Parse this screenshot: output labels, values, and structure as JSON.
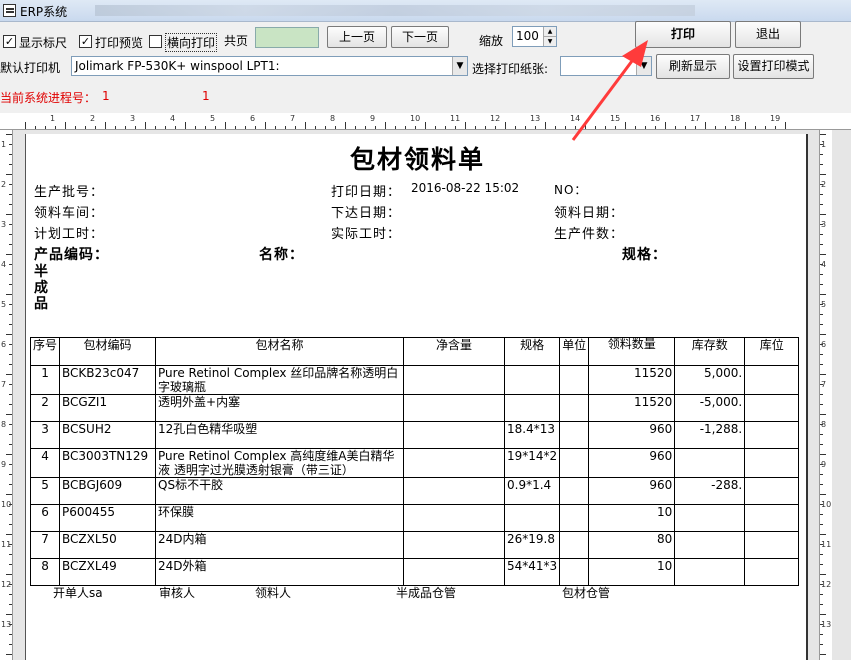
{
  "window": {
    "title": "ERP系统"
  },
  "toolbar": {
    "show_ruler_label": "显示标尺",
    "show_ruler_checked": "✓",
    "print_preview_label": "打印预览",
    "print_preview_checked": "✓",
    "landscape_label": "横向打印",
    "landscape_checked": "",
    "total_pages_label": "共页",
    "total_pages_value": "",
    "prev_page": "上一页",
    "next_page": "下一页",
    "zoom_label": "缩放",
    "zoom_value": "100",
    "print_button": "打印",
    "exit_button": "退出",
    "default_printer_label": "默认打印机",
    "printer_value": "Jolimark FP-530K+  winspool  LPT1:",
    "paper_label": "选择打印纸张:",
    "paper_value": "",
    "refresh_button": "刷新显示",
    "setup_button": "设置打印模式",
    "process_label": "当前系统进程号：",
    "process_value_1": "1",
    "process_value_2": "1"
  },
  "ruler": {
    "h_numbers": [
      "1",
      "2",
      "3",
      "4",
      "5",
      "6",
      "7",
      "8",
      "9",
      "10",
      "11",
      "12",
      "13",
      "14",
      "15",
      "16",
      "17",
      "18",
      "19"
    ],
    "v_numbers": [
      "1",
      "2",
      "3",
      "4",
      "5",
      "6",
      "7",
      "8",
      "9",
      "10",
      "11",
      "12",
      "13"
    ]
  },
  "document": {
    "title": "包材领料单",
    "batch_label": "生产批号：",
    "print_date_label": "打印日期：",
    "print_date_value": "2016-08-22  15:02",
    "no_label": "NO：",
    "workshop_label": "领料车间：",
    "issue_date_label": "下达日期：",
    "pick_date_label": "领料日期：",
    "plan_hours_label": "计划工时：",
    "actual_hours_label": "实际工时：",
    "prod_qty_label": "生产件数：",
    "product_code_label": "产品编码：",
    "name_label": "名称：",
    "spec_label": "规格：",
    "semi_label": "半成品",
    "columns": [
      "序号",
      "包材编码",
      "包材名称",
      "净含量",
      "规格",
      "单位",
      "领料数量",
      "库存数",
      "库位"
    ],
    "rows": [
      {
        "no": "1",
        "code": "BCKB23c047",
        "name": "Pure Retinol Complex 丝印品牌名称透明白字玻璃瓶",
        "net": "",
        "spec": "",
        "unit": "",
        "qty": "11520",
        "stock": "5,000.",
        "loc": ""
      },
      {
        "no": "2",
        "code": "BCGZI1",
        "name": "透明外盖+内塞",
        "net": "",
        "spec": "",
        "unit": "",
        "qty": "11520",
        "stock": "-5,000.",
        "loc": ""
      },
      {
        "no": "3",
        "code": "BCSUH2",
        "name": "12孔白色精华吸塑",
        "net": "",
        "spec": "18.4*13",
        "unit": "",
        "qty": "960",
        "stock": "-1,288.",
        "loc": ""
      },
      {
        "no": "4",
        "code": "BC3003TN129",
        "name": "Pure Retinol Complex 高纯度维A美白精华液 透明字过光膜透射银膏（带三证）",
        "net": "",
        "spec": "19*14*2",
        "unit": "",
        "qty": "960",
        "stock": "",
        "loc": ""
      },
      {
        "no": "5",
        "code": "BCBGJ609",
        "name": "QS标不干胶",
        "net": "",
        "spec": "0.9*1.4",
        "unit": "",
        "qty": "960",
        "stock": "-288.",
        "loc": ""
      },
      {
        "no": "6",
        "code": "P600455",
        "name": "环保膜",
        "net": "",
        "spec": "",
        "unit": "",
        "qty": "10",
        "stock": "",
        "loc": ""
      },
      {
        "no": "7",
        "code": "BCZXL50",
        "name": "24D内箱",
        "net": "",
        "spec": "26*19.8",
        "unit": "",
        "qty": "80",
        "stock": "",
        "loc": ""
      },
      {
        "no": "8",
        "code": "BCZXL49",
        "name": "24D外箱",
        "net": "",
        "spec": "54*41*3",
        "unit": "",
        "qty": "10",
        "stock": "",
        "loc": ""
      }
    ],
    "footer": {
      "creator": "开单人sa",
      "reviewer": "审核人",
      "picker": "领料人",
      "semi_warehouse": "半成品仓管",
      "pack_warehouse": "包材仓管"
    }
  },
  "colors": {
    "annotation_arrow": "#ff3b3b",
    "process_text": "#e00000",
    "pages_field": "#c9e4c4"
  }
}
